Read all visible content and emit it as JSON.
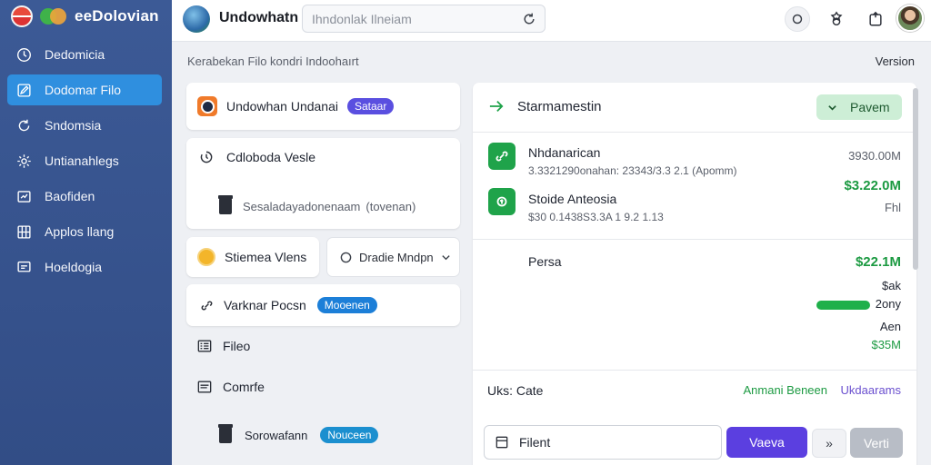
{
  "brand": {
    "name": "eeDolovian"
  },
  "sidebar": {
    "items": [
      {
        "label": "Dedomicia",
        "icon": "clock-icon",
        "active": false
      },
      {
        "label": "Dodomar Filo",
        "icon": "edit-icon",
        "active": true
      },
      {
        "label": "Sndomsia",
        "icon": "refresh-icon",
        "active": false
      },
      {
        "label": "Untianahlegs",
        "icon": "gear-icon",
        "active": false
      },
      {
        "label": "Baofiden",
        "icon": "chart-icon",
        "active": false
      },
      {
        "label": "Applos llang",
        "icon": "grid-icon",
        "active": false
      },
      {
        "label": "Hoeldogia",
        "icon": "message-icon",
        "active": false
      }
    ]
  },
  "header": {
    "title": "Undowhatn",
    "search_placeholder": "Ihndonlak Ilneiam"
  },
  "breadcrumb": "Kerabekan Filo kondri Indoohaırt",
  "version": "Version",
  "left": {
    "card1": {
      "title": "Undowhan Undanai",
      "badge": "Sataar"
    },
    "card2": {
      "title": "Cdloboda Vesle",
      "subtitle": "Sesaladayadonenaam",
      "note": "(tovenan)"
    },
    "chip_left": "Stiemea Vlens",
    "chip_right": "Dradie Mndpn",
    "card3": {
      "title": "Varknar Pocsn",
      "badge": "Mooenen"
    },
    "list": [
      {
        "label": "Fileo",
        "icon": "list-icon"
      },
      {
        "label": "Comrfe",
        "icon": "document-icon"
      }
    ],
    "bottom": {
      "label": "Sorowafann",
      "badge": "Nouceen"
    }
  },
  "right": {
    "title": "Starmamestin",
    "status_button": "Pavem",
    "items": [
      {
        "name": "Nhdanarican",
        "detail": "3.3321290onahan: 23343/3.3 2.1 (Apomm)",
        "amount": "3930.00M",
        "icon": "link-icon"
      },
      {
        "name": "Stoide Anteosia",
        "detail": "$30 0.1438S3.3A 1 9.2 1.13",
        "amount": "$3.22.0M",
        "sub": "Fhl",
        "icon": "tag-icon"
      }
    ],
    "pers": {
      "label": "Persa",
      "amount": "$22.1M",
      "lines": [
        "$ak",
        "2ony"
      ],
      "bar_fraction": 0.65,
      "aen": "Aen",
      "total": "$35M"
    },
    "footer": {
      "label": "Uks: Cate",
      "link1": "Anmani Beneen",
      "link2": "Ukdaarams"
    },
    "input_placeholder": "Filent",
    "btn_primary": "Vaeva",
    "btn_dropdown": "»",
    "btn_secondary": "Verti"
  },
  "colors": {
    "sidebar": "#3c5a96",
    "accent": "#5a4fe0",
    "green": "#1fa34a",
    "active": "#2f8fdf"
  }
}
